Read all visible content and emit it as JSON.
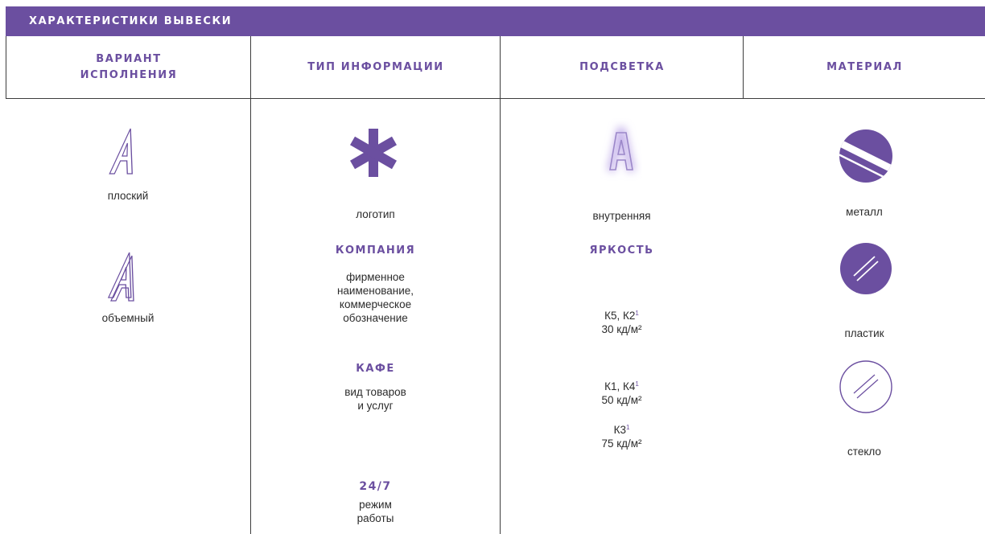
{
  "title": "ХАРАКТЕРИСТИКИ ВЫВЕСКИ",
  "columns": {
    "variant": "ВАРИАНТ ИСПОЛНЕНИЯ",
    "info_type": "ТИП ИНФОРМАЦИИ",
    "lighting": "ПОДСВЕТКА",
    "material": "МАТЕРИАЛ"
  },
  "variant": {
    "flat": "плоский",
    "volume": "объемный"
  },
  "info": {
    "logo": "логотип",
    "company_label": "КОМПАНИЯ",
    "company_line1": "фирменное",
    "company_line2": "наименование,",
    "company_line3": "коммерческое",
    "company_line4": "обозначение",
    "cafe_label": "КАФЕ",
    "cafe_line1": "вид товаров",
    "cafe_line2": "и услуг",
    "hours_label": "24/7",
    "hours_line1": "режим",
    "hours_line2": "работы"
  },
  "lighting": {
    "internal": "внутренняя",
    "brightness_label": "ЯРКОСТЬ",
    "levels": [
      {
        "classes": "К5, К2",
        "note": "1",
        "value": "30 кд/м²"
      },
      {
        "classes": "К1, К4",
        "note": "1",
        "value": "50 кд/м²"
      },
      {
        "classes": "К3",
        "note": "1",
        "value": "75 кд/м²"
      }
    ]
  },
  "material": {
    "metal": "металл",
    "plastic": "пластик",
    "glass": "стекло"
  },
  "colors": {
    "accent": "#6b4fa0",
    "line": "#3d3d3d",
    "text": "#2b2b2b"
  }
}
